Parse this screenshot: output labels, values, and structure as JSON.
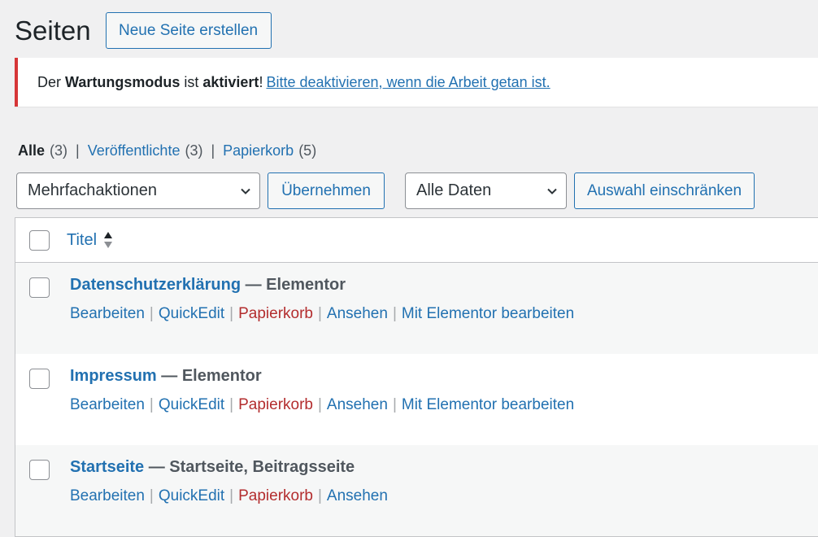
{
  "header": {
    "title": "Seiten",
    "new_page_button": "Neue Seite erstellen"
  },
  "notice": {
    "prefix": "Der",
    "bold1": "Wartungsmodus",
    "middle": "ist",
    "bold2": "aktiviert",
    "exclaim": "!",
    "link": "Bitte deaktivieren, wenn die Arbeit getan ist.",
    "border_color": "#d63638"
  },
  "views": {
    "all_label": "Alle",
    "all_count": "(3)",
    "published_label": "Veröffentlichte",
    "published_count": "(3)",
    "trash_label": "Papierkorb",
    "trash_count": "(5)",
    "separator": "|"
  },
  "tablenav": {
    "bulk_select": "Mehrfachaktionen",
    "apply_button": "Übernehmen",
    "dates_select": "Alle Daten",
    "filter_button": "Auswahl einschränken"
  },
  "table": {
    "column_title": "Titel",
    "rows": [
      {
        "title": "Datenschutzerklärung",
        "state": "— Elementor",
        "actions": [
          "Bearbeiten",
          "QuickEdit",
          "Papierkorb",
          "Ansehen",
          "Mit Elementor bearbeiten"
        ]
      },
      {
        "title": "Impressum",
        "state": "— Elementor",
        "actions": [
          "Bearbeiten",
          "QuickEdit",
          "Papierkorb",
          "Ansehen",
          "Mit Elementor bearbeiten"
        ]
      },
      {
        "title": "Startseite",
        "state": "— Startseite, Beitragsseite",
        "actions": [
          "Bearbeiten",
          "QuickEdit",
          "Papierkorb",
          "Ansehen"
        ]
      }
    ]
  },
  "colors": {
    "link": "#2271b1",
    "trash": "#b32d2e",
    "background": "#f0f0f1"
  }
}
